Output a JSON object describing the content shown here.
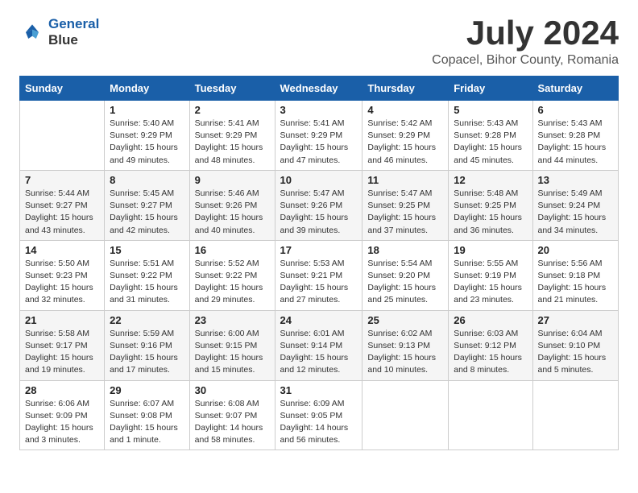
{
  "logo": {
    "line1": "General",
    "line2": "Blue"
  },
  "title": "July 2024",
  "location": "Copacel, Bihor County, Romania",
  "weekdays": [
    "Sunday",
    "Monday",
    "Tuesday",
    "Wednesday",
    "Thursday",
    "Friday",
    "Saturday"
  ],
  "weeks": [
    [
      {
        "day": "",
        "info": ""
      },
      {
        "day": "1",
        "info": "Sunrise: 5:40 AM\nSunset: 9:29 PM\nDaylight: 15 hours\nand 49 minutes."
      },
      {
        "day": "2",
        "info": "Sunrise: 5:41 AM\nSunset: 9:29 PM\nDaylight: 15 hours\nand 48 minutes."
      },
      {
        "day": "3",
        "info": "Sunrise: 5:41 AM\nSunset: 9:29 PM\nDaylight: 15 hours\nand 47 minutes."
      },
      {
        "day": "4",
        "info": "Sunrise: 5:42 AM\nSunset: 9:29 PM\nDaylight: 15 hours\nand 46 minutes."
      },
      {
        "day": "5",
        "info": "Sunrise: 5:43 AM\nSunset: 9:28 PM\nDaylight: 15 hours\nand 45 minutes."
      },
      {
        "day": "6",
        "info": "Sunrise: 5:43 AM\nSunset: 9:28 PM\nDaylight: 15 hours\nand 44 minutes."
      }
    ],
    [
      {
        "day": "7",
        "info": "Sunrise: 5:44 AM\nSunset: 9:27 PM\nDaylight: 15 hours\nand 43 minutes."
      },
      {
        "day": "8",
        "info": "Sunrise: 5:45 AM\nSunset: 9:27 PM\nDaylight: 15 hours\nand 42 minutes."
      },
      {
        "day": "9",
        "info": "Sunrise: 5:46 AM\nSunset: 9:26 PM\nDaylight: 15 hours\nand 40 minutes."
      },
      {
        "day": "10",
        "info": "Sunrise: 5:47 AM\nSunset: 9:26 PM\nDaylight: 15 hours\nand 39 minutes."
      },
      {
        "day": "11",
        "info": "Sunrise: 5:47 AM\nSunset: 9:25 PM\nDaylight: 15 hours\nand 37 minutes."
      },
      {
        "day": "12",
        "info": "Sunrise: 5:48 AM\nSunset: 9:25 PM\nDaylight: 15 hours\nand 36 minutes."
      },
      {
        "day": "13",
        "info": "Sunrise: 5:49 AM\nSunset: 9:24 PM\nDaylight: 15 hours\nand 34 minutes."
      }
    ],
    [
      {
        "day": "14",
        "info": "Sunrise: 5:50 AM\nSunset: 9:23 PM\nDaylight: 15 hours\nand 32 minutes."
      },
      {
        "day": "15",
        "info": "Sunrise: 5:51 AM\nSunset: 9:22 PM\nDaylight: 15 hours\nand 31 minutes."
      },
      {
        "day": "16",
        "info": "Sunrise: 5:52 AM\nSunset: 9:22 PM\nDaylight: 15 hours\nand 29 minutes."
      },
      {
        "day": "17",
        "info": "Sunrise: 5:53 AM\nSunset: 9:21 PM\nDaylight: 15 hours\nand 27 minutes."
      },
      {
        "day": "18",
        "info": "Sunrise: 5:54 AM\nSunset: 9:20 PM\nDaylight: 15 hours\nand 25 minutes."
      },
      {
        "day": "19",
        "info": "Sunrise: 5:55 AM\nSunset: 9:19 PM\nDaylight: 15 hours\nand 23 minutes."
      },
      {
        "day": "20",
        "info": "Sunrise: 5:56 AM\nSunset: 9:18 PM\nDaylight: 15 hours\nand 21 minutes."
      }
    ],
    [
      {
        "day": "21",
        "info": "Sunrise: 5:58 AM\nSunset: 9:17 PM\nDaylight: 15 hours\nand 19 minutes."
      },
      {
        "day": "22",
        "info": "Sunrise: 5:59 AM\nSunset: 9:16 PM\nDaylight: 15 hours\nand 17 minutes."
      },
      {
        "day": "23",
        "info": "Sunrise: 6:00 AM\nSunset: 9:15 PM\nDaylight: 15 hours\nand 15 minutes."
      },
      {
        "day": "24",
        "info": "Sunrise: 6:01 AM\nSunset: 9:14 PM\nDaylight: 15 hours\nand 12 minutes."
      },
      {
        "day": "25",
        "info": "Sunrise: 6:02 AM\nSunset: 9:13 PM\nDaylight: 15 hours\nand 10 minutes."
      },
      {
        "day": "26",
        "info": "Sunrise: 6:03 AM\nSunset: 9:12 PM\nDaylight: 15 hours\nand 8 minutes."
      },
      {
        "day": "27",
        "info": "Sunrise: 6:04 AM\nSunset: 9:10 PM\nDaylight: 15 hours\nand 5 minutes."
      }
    ],
    [
      {
        "day": "28",
        "info": "Sunrise: 6:06 AM\nSunset: 9:09 PM\nDaylight: 15 hours\nand 3 minutes."
      },
      {
        "day": "29",
        "info": "Sunrise: 6:07 AM\nSunset: 9:08 PM\nDaylight: 15 hours\nand 1 minute."
      },
      {
        "day": "30",
        "info": "Sunrise: 6:08 AM\nSunset: 9:07 PM\nDaylight: 14 hours\nand 58 minutes."
      },
      {
        "day": "31",
        "info": "Sunrise: 6:09 AM\nSunset: 9:05 PM\nDaylight: 14 hours\nand 56 minutes."
      },
      {
        "day": "",
        "info": ""
      },
      {
        "day": "",
        "info": ""
      },
      {
        "day": "",
        "info": ""
      }
    ]
  ]
}
